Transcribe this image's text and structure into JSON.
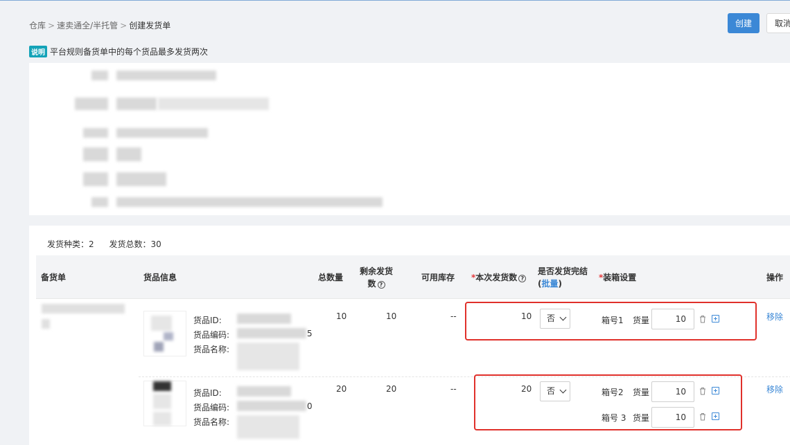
{
  "breadcrumb": [
    "仓库",
    "速卖通全/半托管",
    "创建发货单"
  ],
  "breadcrumb_sep": ">",
  "actions": {
    "create": "创建",
    "cancel": "取消"
  },
  "notice": {
    "tag": "说明",
    "text": "平台规则备货单中的每个货品最多发货两次"
  },
  "summary": {
    "kinds": "发货种类：2",
    "total": "发货总数：30"
  },
  "table": {
    "headers": {
      "stock_order": "备货单",
      "goods_info": "货品信息",
      "total_qty": "总数量",
      "remaining_1": "剩余发货",
      "remaining_2": "数",
      "available": "可用库存",
      "req_mark": "*",
      "ship_qty": "本次发货数",
      "complete_1": "是否发货完结",
      "complete_paren_open": "(",
      "complete_link": "批量",
      "complete_paren_close": ")",
      "packing": "装箱设置",
      "ops": "操作"
    },
    "goods_labels": {
      "id": "货品ID:",
      "code": "货品编码:",
      "name": "货品名称:"
    },
    "rows": [
      {
        "total": "10",
        "remaining": "10",
        "available": "--",
        "ship": "10",
        "complete": "否",
        "code_tail": "5",
        "boxes": [
          {
            "box": "箱号1",
            "qty_label": "货量",
            "qty": "10"
          }
        ],
        "remove": "移除"
      },
      {
        "total": "20",
        "remaining": "20",
        "available": "--",
        "ship": "20",
        "complete": "否",
        "code_tail": "0",
        "boxes": [
          {
            "box": "箱号2",
            "qty_label": "货量",
            "qty": "10"
          },
          {
            "box": "箱号 3",
            "qty_label": "货量",
            "qty": "10"
          }
        ],
        "remove": "移除"
      }
    ]
  },
  "icons": {
    "help": "question-circle-icon",
    "select": "chevron-down-icon",
    "delete": "trash-icon",
    "add": "plus-square-icon"
  },
  "colors": {
    "primary": "#3b88d6",
    "required": "#e4393c",
    "highlight_box": "#e0302a",
    "tag": "#14a3b8"
  }
}
